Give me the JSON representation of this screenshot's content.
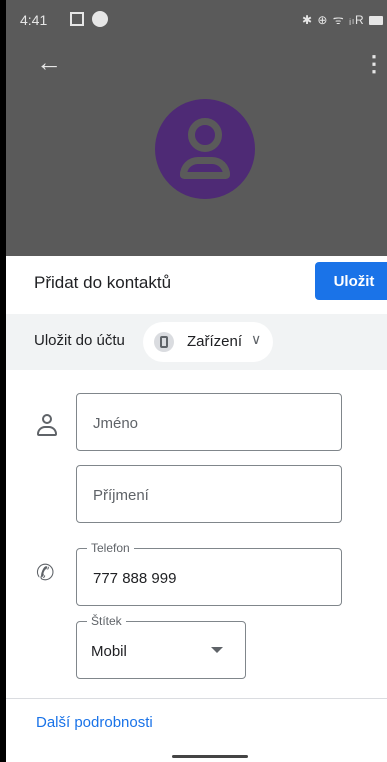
{
  "status_bar": {
    "time": "4:41",
    "right": "✱ ⊕ ᯤ ᵢₗR"
  },
  "header": {
    "title": "Přidat do kontaktů",
    "save_label": "Uložit"
  },
  "account": {
    "label": "Uložit do účtu",
    "selected": "Zařízení"
  },
  "form": {
    "first_name_placeholder": "Jméno",
    "last_name_placeholder": "Příjmení",
    "phone_label": "Telefon",
    "phone_value": "777 888 999",
    "type_label": "Štítek",
    "type_value": "Mobil"
  },
  "more_link": "Další podrobnosti",
  "colors": {
    "accent": "#1a73e8",
    "avatar": "#4e2a75",
    "scrim": "#5a5a5a"
  }
}
